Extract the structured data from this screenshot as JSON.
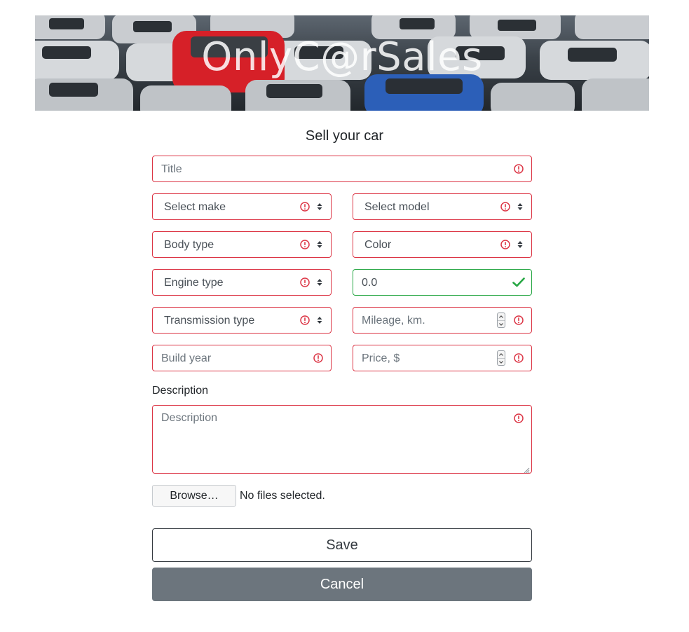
{
  "banner": {
    "brand": "OnlyC@rSales"
  },
  "form": {
    "heading": "Sell your car",
    "title_placeholder": "Title",
    "make_selected": "Select make",
    "model_selected": "Select model",
    "body_type_selected": "Body type",
    "color_selected": "Color",
    "engine_type_selected": "Engine type",
    "engine_volume_value": "0.0",
    "transmission_selected": "Transmission type",
    "mileage_placeholder": "Mileage, km.",
    "build_year_placeholder": "Build year",
    "price_placeholder": "Price, $",
    "description_label": "Description",
    "description_placeholder": "Description",
    "browse_label": "Browse…",
    "no_files_text": "No files selected.",
    "save_label": "Save",
    "cancel_label": "Cancel"
  },
  "colors": {
    "invalid": "#dc3545",
    "valid": "#28a745",
    "cancel_bg": "#6c757d"
  },
  "icons": {
    "invalid": "exclamation-circle-icon",
    "valid": "check-icon",
    "select": "sort-carets-icon"
  }
}
